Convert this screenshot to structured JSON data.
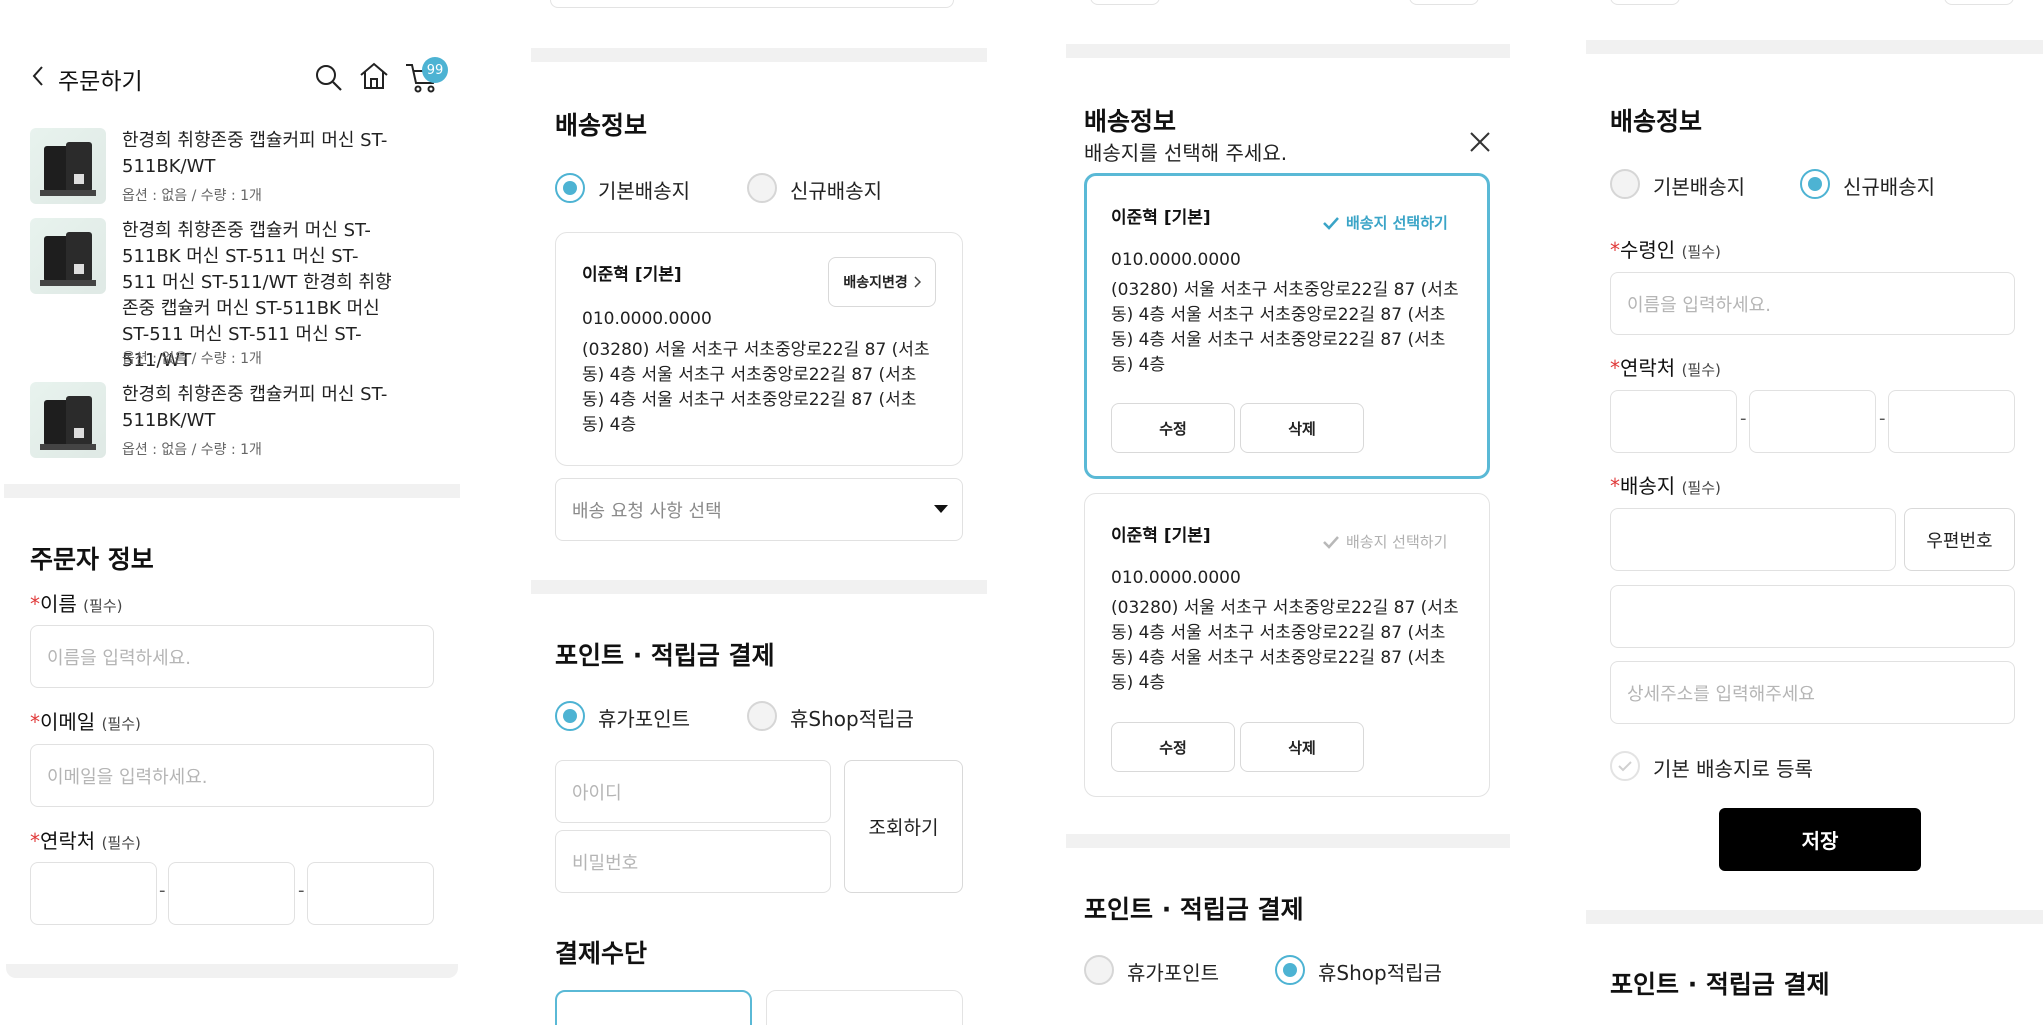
{
  "header": {
    "title": "주문하기",
    "cart_count": "99"
  },
  "products": [
    {
      "name": "한경희 취향존중 캡슐커피 머신 ST-511BK/WT",
      "option": "옵션 : 없음 / 수량 : 1개"
    },
    {
      "name": "한경희 취향존중 캡슐커 머신 ST-511BK 머신 ST-511 머신 ST-511 머신 ST-511/WT 한경희 취향존중 캡슐커 머신 ST-511BK 머신 ST-511 머신 ST-511 머신 ST-511/WT",
      "option": "옵션 : 없음 / 수량 : 1개"
    },
    {
      "name": "한경희 취향존중 캡슐커피 머신 ST-511BK/WT",
      "option": "옵션 : 없음 / 수량 : 1개"
    }
  ],
  "orderer": {
    "title": "주문자 정보",
    "name_label": "이름",
    "email_label": "이메일",
    "phone_label": "연락처",
    "required": "(필수)",
    "star": "*",
    "name_placeholder": "이름을 입력하세요.",
    "email_placeholder": "이메일을 입력하세요.",
    "dash": "-"
  },
  "shipping": {
    "title": "배송정보",
    "default_option": "기본배송지",
    "new_option": "신규배송지",
    "addr_name": "이준혁 [기본]",
    "addr_phone": "010.0000.0000",
    "addr_text": "(03280) 서울 서초구 서초중앙로22길 87 (서초동) 4층 서울 서초구 서초중앙로22길 87 (서초동) 4층 서울 서초구 서초중앙로22길 87 (서초동) 4층",
    "change_button": "배송지변경",
    "request_placeholder": "배송 요청 사항 선택"
  },
  "points": {
    "title": "포인트 · 적립금 결제",
    "option_a": "휴가포인트",
    "option_b": "휴Shop적립금",
    "id_placeholder": "아이디",
    "pw_placeholder": "비밀번호",
    "lookup_button": "조회하기"
  },
  "payment": {
    "title": "결제수단"
  },
  "modal": {
    "title": "배송정보",
    "subtitle": "배송지를 선택해 주세요.",
    "select_label": "배송지 선택하기",
    "edit_button": "수정",
    "delete_button": "삭제"
  },
  "new_address": {
    "recipient_label": "수령인",
    "phone_label": "연락처",
    "address_label": "배송지",
    "recipient_placeholder": "이름을 입력하세요.",
    "zip_button": "우편번호",
    "detail_placeholder": "상세주소를 입력해주세요",
    "default_check": "기본 배송지로 등록",
    "save_button": "저장"
  },
  "colors": {
    "accent": "#4db3d3",
    "required_star": "#e03a3a",
    "save_bg": "#000000"
  }
}
